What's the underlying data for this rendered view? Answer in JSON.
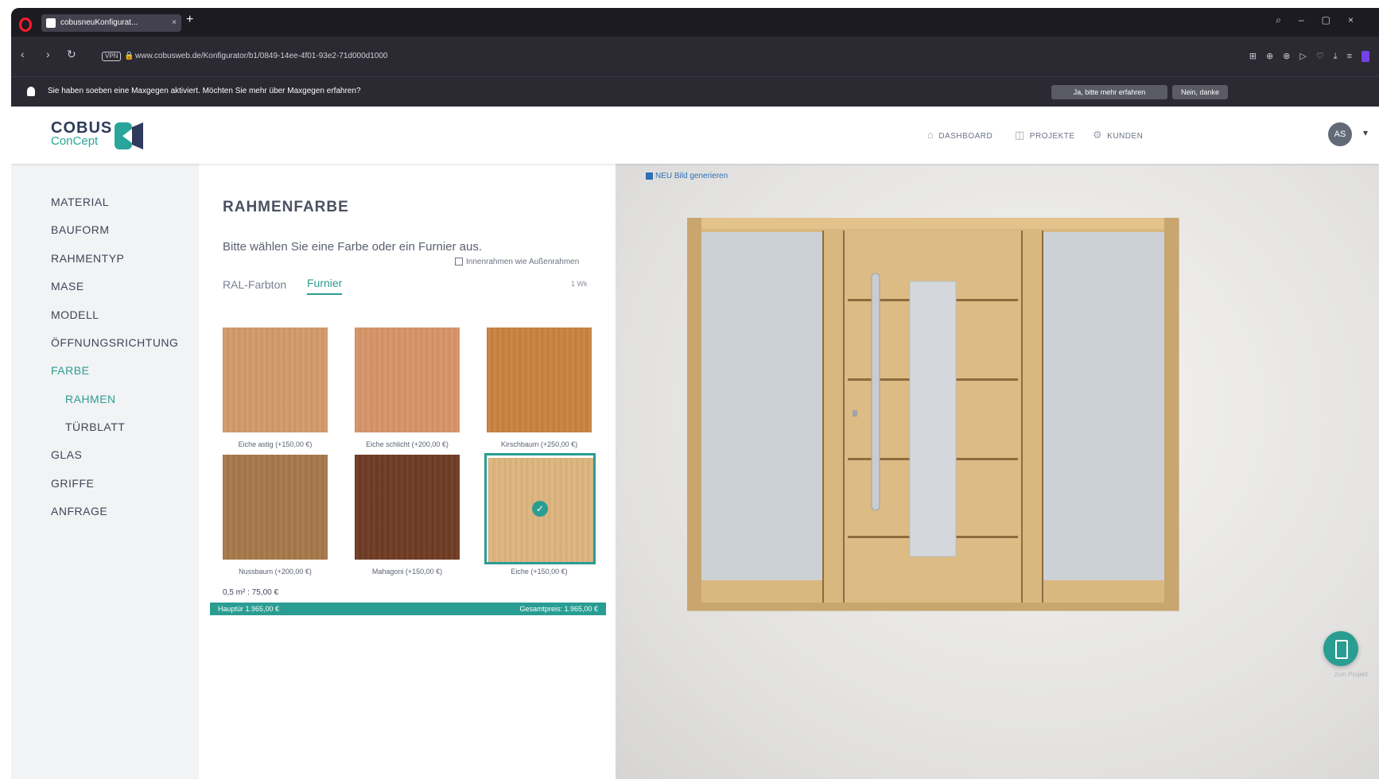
{
  "browser": {
    "tab_title": "cobusneuKonfigurat...",
    "tab_close": "×",
    "new_tab": "+",
    "url": "www.cobusweb.de/Konfigurator/b1/0849-14ee-4f01-93e2-71d000d1000",
    "vpn_label": "VPN",
    "notification": "Sie haben soeben eine Maxgegen aktiviert. Möchten Sie mehr über Maxgegen erfahren?",
    "notif_btn_1": "Ja, bitte mehr erfahren",
    "notif_btn_2": "Nein, danke"
  },
  "header": {
    "logo_line1": "COBUS",
    "logo_line2": "ConCept",
    "nav": [
      {
        "label": "DASHBOARD",
        "icon": "dashboard-icon"
      },
      {
        "label": "PROJEKTE",
        "icon": "projects-icon"
      },
      {
        "label": "KUNDEN",
        "icon": "customers-icon"
      }
    ],
    "avatar": "AS"
  },
  "sidebar": {
    "items": [
      {
        "label": "MATERIAL"
      },
      {
        "label": "BAUFORM"
      },
      {
        "label": "RAHMENTYP"
      },
      {
        "label": "MASE"
      },
      {
        "label": "MODELL"
      },
      {
        "label": "ÖFFNUNGSRICHTUNG"
      },
      {
        "label": "FARBE",
        "active": true
      },
      {
        "label": "RAHMEN",
        "active": true,
        "sub": true
      },
      {
        "label": "TÜRBLATT",
        "sub": true
      },
      {
        "label": "GLAS"
      },
      {
        "label": "GRIFFE"
      },
      {
        "label": "ANFRAGE"
      }
    ]
  },
  "panel": {
    "title": "RAHMENFARBE",
    "instruction": "Bitte wählen Sie eine Farbe oder ein Furnier aus.",
    "checkbox_label": "Innenrahmen wie Außenrahmen",
    "tabs": [
      "RAL-Farbton",
      "Furnier"
    ],
    "active_tab": "Furnier",
    "tab_right_value": "1 Wk",
    "swatches": [
      {
        "label": "Eiche astig (+150,00 €)",
        "color": "#d49a6a"
      },
      {
        "label": "Eiche schlicht (+200,00 €)",
        "color": "#d89468"
      },
      {
        "label": "Kirschbaum (+250,00 €)",
        "color": "#c9823e"
      },
      {
        "label": "Nussbaum (+200,00 €)",
        "color": "#a67848"
      },
      {
        "label": "Mahagoni (+150,00 €)",
        "color": "#6e3a22"
      },
      {
        "label": "Eiche (+150,00 €)",
        "color": "#dfb57e",
        "selected": true
      }
    ],
    "area_line": "0,5 m² : 75,00 €",
    "price_left": "Hauptür 1.965,00 €",
    "price_right": "Gesamtpreis: 1.965,00 €"
  },
  "preview": {
    "save_link": "NEU Bild generieren",
    "fab_label": "zum Projekt"
  },
  "colors": {
    "accent": "#2a9d92",
    "wood_frame": "#d7b57d",
    "glass": "#c9ced4"
  }
}
